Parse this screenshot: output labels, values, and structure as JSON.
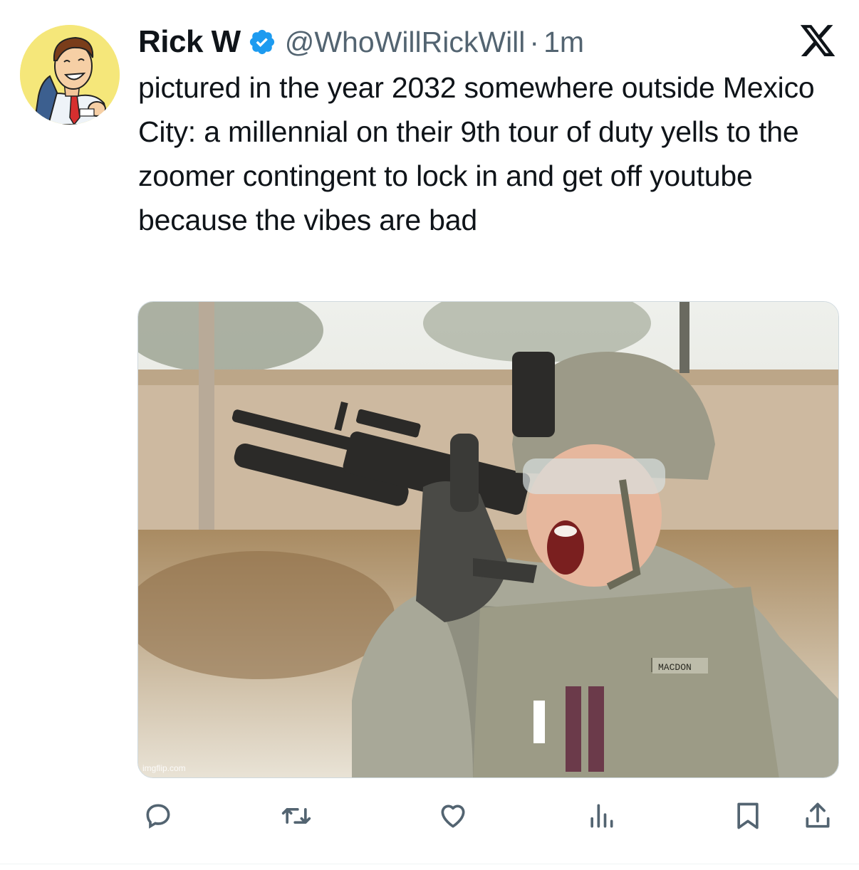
{
  "author": {
    "name": "Rick W",
    "handle": "@WhoWillRickWill",
    "separator": "·",
    "time": "1m",
    "verified": true
  },
  "tweet": {
    "text": "pictured in the year 2032 somewhere outside Mexico City: a millennial on their 9th tour of duty yells to the zoomer contingent to lock in and get off youtube because the vibes are bad"
  },
  "media": {
    "watermark": "imgflip.com"
  },
  "photo_labels": {
    "name_tape": "MACDON"
  },
  "actions": {
    "icons": [
      "reply-icon",
      "retweet-icon",
      "like-icon",
      "views-icon",
      "bookmark-icon",
      "share-icon"
    ]
  },
  "colors": {
    "verified": "#1d9bf0",
    "secondary_text": "#536471",
    "icon": "#536471",
    "avatar_bg": "#f5e77a"
  }
}
